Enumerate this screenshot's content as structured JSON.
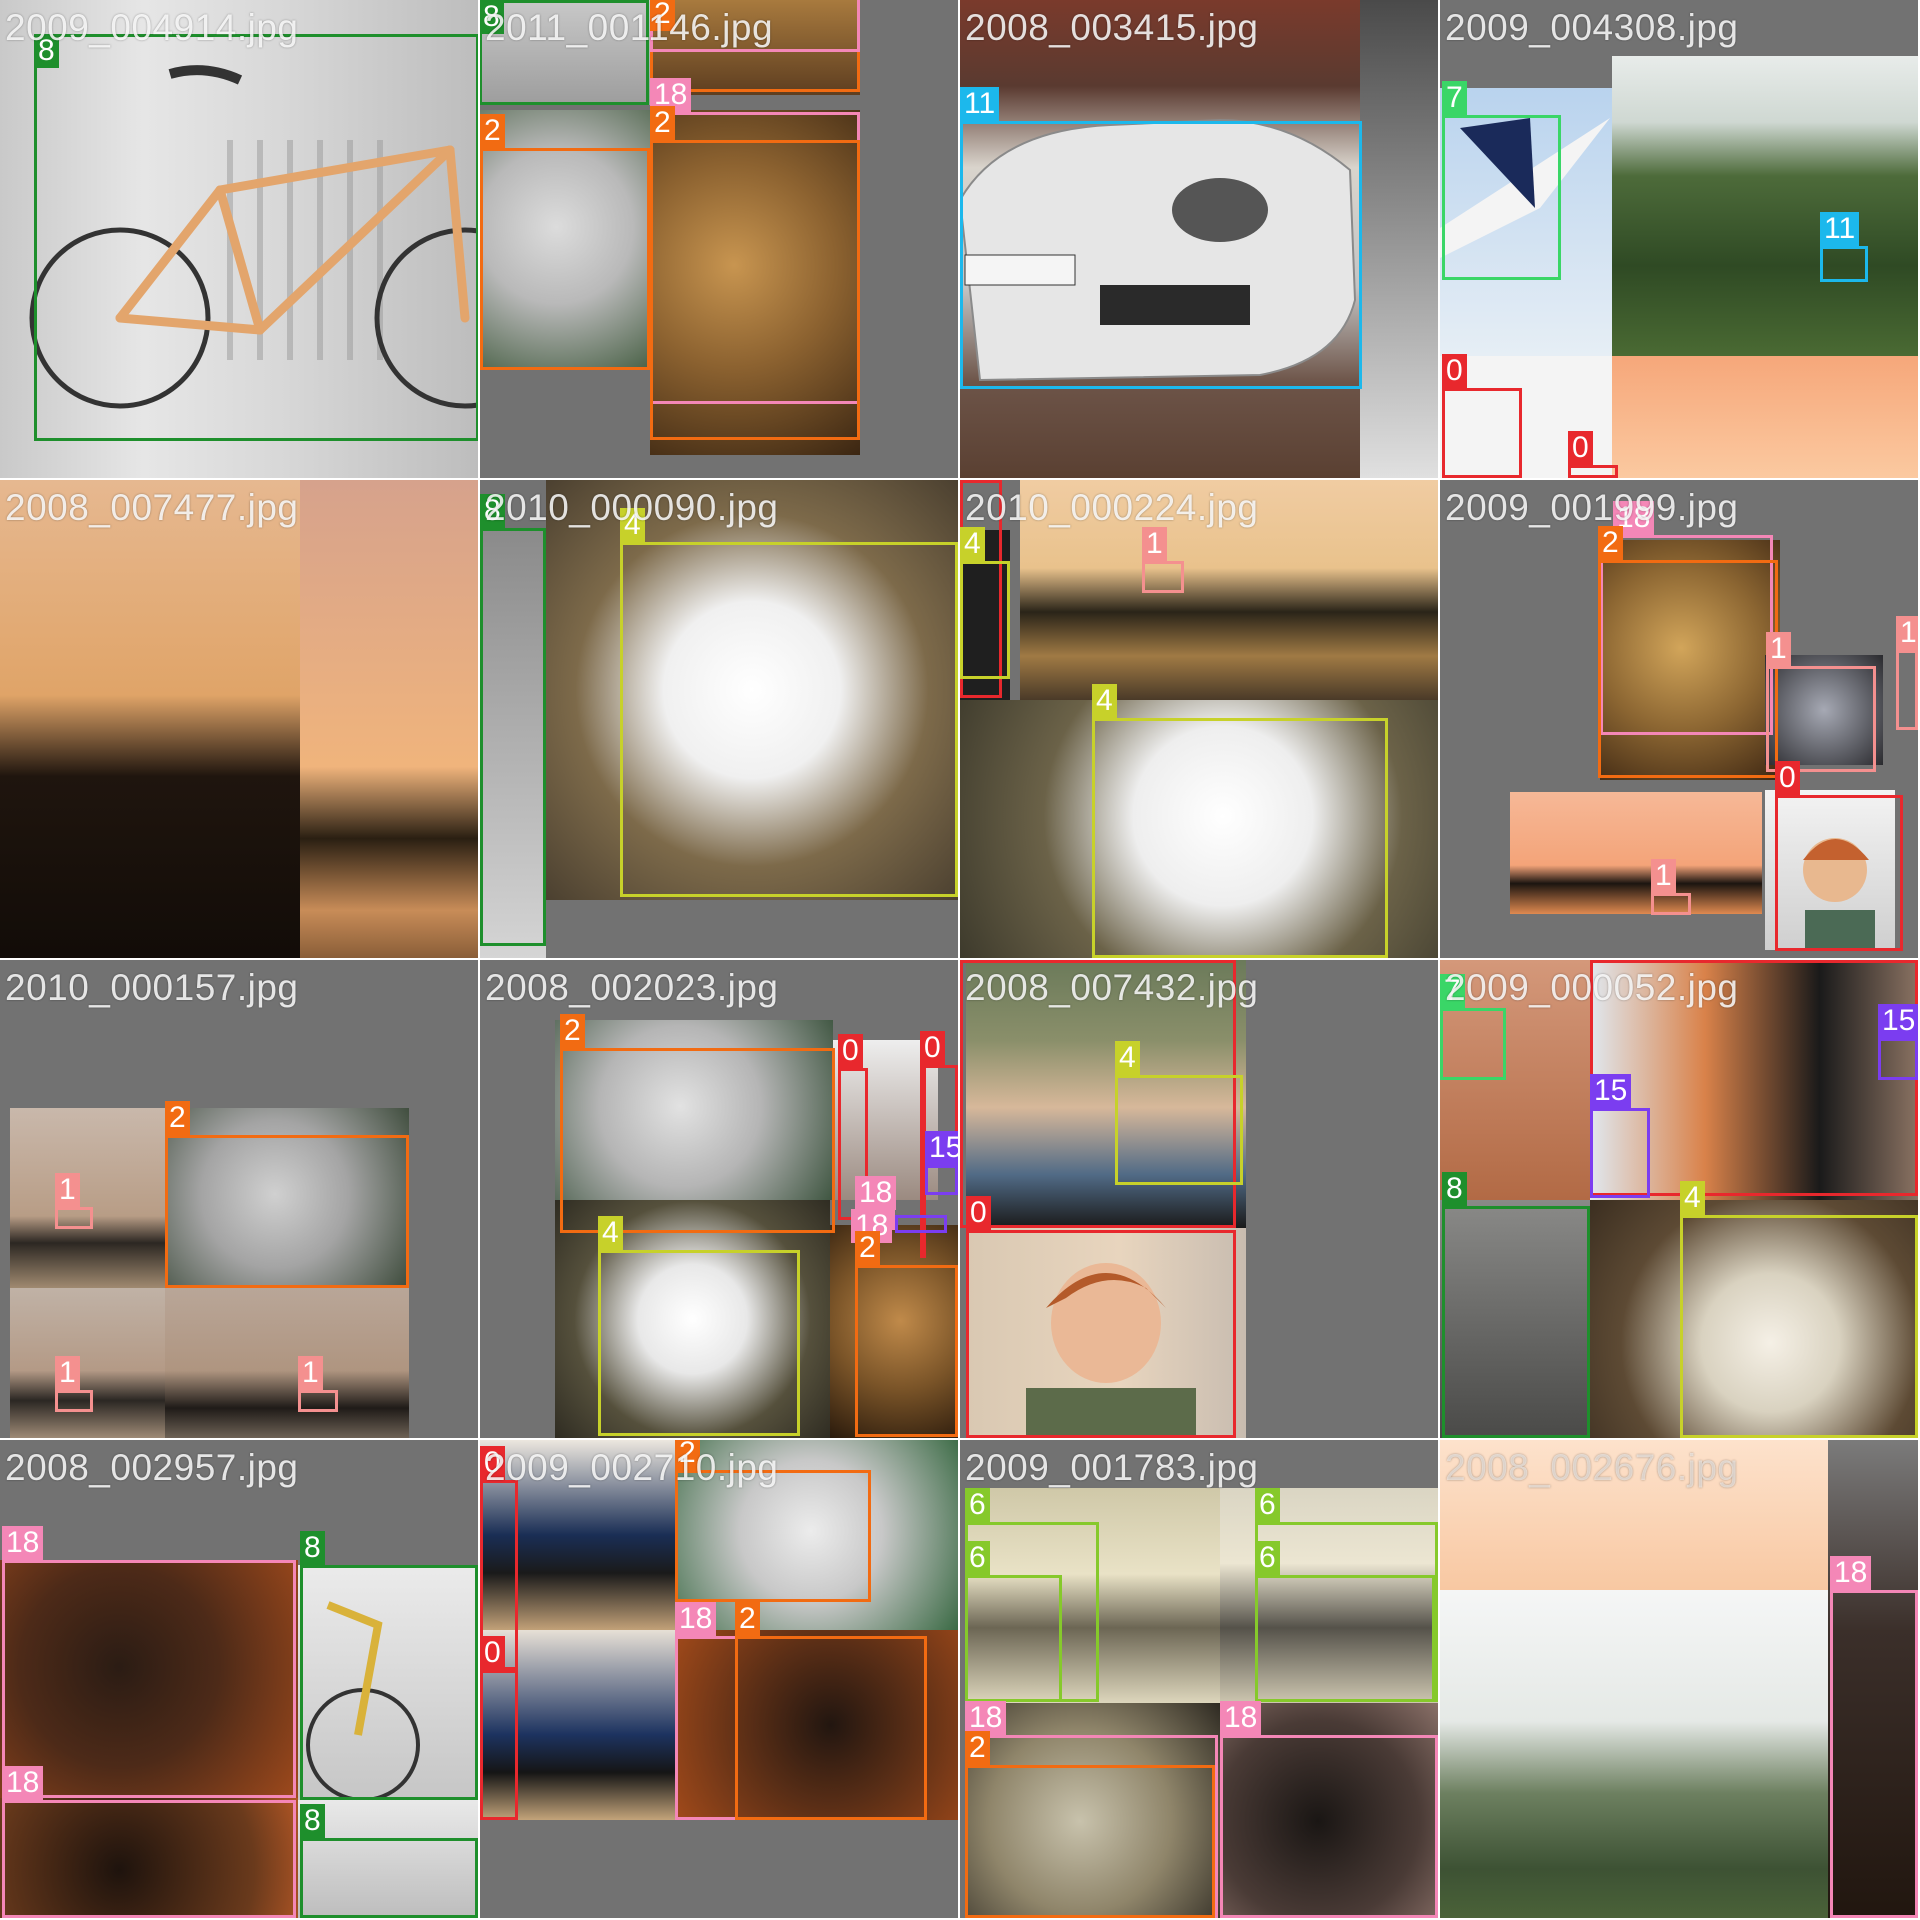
{
  "class_colors": {
    "0": "#e8282d",
    "1": "#f4908f",
    "2": "#f26b12",
    "4": "#c7d12a",
    "6": "#86c92b",
    "7": "#3ad667",
    "8": "#1e8f2c",
    "11": "#1cb8ec",
    "15": "#7b3df0",
    "18": "#f487b7"
  },
  "tiles": [
    {
      "name": "2009_004914.jpg",
      "labels": {
        "b0": "8",
        "b1": "8"
      }
    },
    {
      "name": "2011_001146.jpg",
      "labels": {
        "b0": "8",
        "b1": "2",
        "b2": "8",
        "b3": "18",
        "b4": "2",
        "b5": "2"
      }
    },
    {
      "name": "2008_003415.jpg",
      "labels": {
        "b0": "11"
      }
    },
    {
      "name": "2009_004308.jpg",
      "labels": {
        "b0": "7",
        "b1": "11",
        "b2": "0",
        "b3": "0"
      }
    },
    {
      "name": "2008_007477.jpg",
      "labels": {}
    },
    {
      "name": "2010_000090.jpg",
      "labels": {
        "b0": "8",
        "b1": "4"
      }
    },
    {
      "name": "2010_000224.jpg",
      "labels": {
        "b0": "0",
        "b1": "4",
        "b2": "1",
        "b3": "4"
      }
    },
    {
      "name": "2009_001999.jpg",
      "labels": {
        "b0": "18",
        "b1": "2",
        "b2": "1",
        "b3": "1",
        "b4": "0",
        "b5": "1"
      }
    },
    {
      "name": "2010_000157.jpg",
      "labels": {
        "b0": "2",
        "b1": "1",
        "b2": "1",
        "b3": "1"
      }
    },
    {
      "name": "2008_002023.jpg",
      "labels": {
        "b0": "2",
        "b1": "0",
        "b2": "0",
        "b3": "15",
        "b4": "18",
        "b5": "18",
        "b6": "4",
        "b7": "2"
      }
    },
    {
      "name": "2008_007432.jpg",
      "labels": {
        "b0": "0",
        "b1": "4",
        "b2": "0"
      }
    },
    {
      "name": "2009_000052.jpg",
      "labels": {
        "b0": "7",
        "b1": "0",
        "b2": "15",
        "b3": "15",
        "b4": "8",
        "b5": "4"
      }
    },
    {
      "name": "2008_002957.jpg",
      "labels": {
        "b0": "18",
        "b1": "8",
        "b2": "18",
        "b3": "8"
      }
    },
    {
      "name": "2009_002710.jpg",
      "labels": {
        "b0": "0",
        "b1": "2",
        "b2": "0",
        "b3": "18",
        "b4": "2"
      }
    },
    {
      "name": "2009_001783.jpg",
      "labels": {
        "b0": "6",
        "b1": "6",
        "b2": "6",
        "b3": "6",
        "b4": "18",
        "b5": "18",
        "b6": "2"
      }
    },
    {
      "name": "2008_002676.jpg",
      "labels": {
        "b0": "18"
      }
    }
  ]
}
